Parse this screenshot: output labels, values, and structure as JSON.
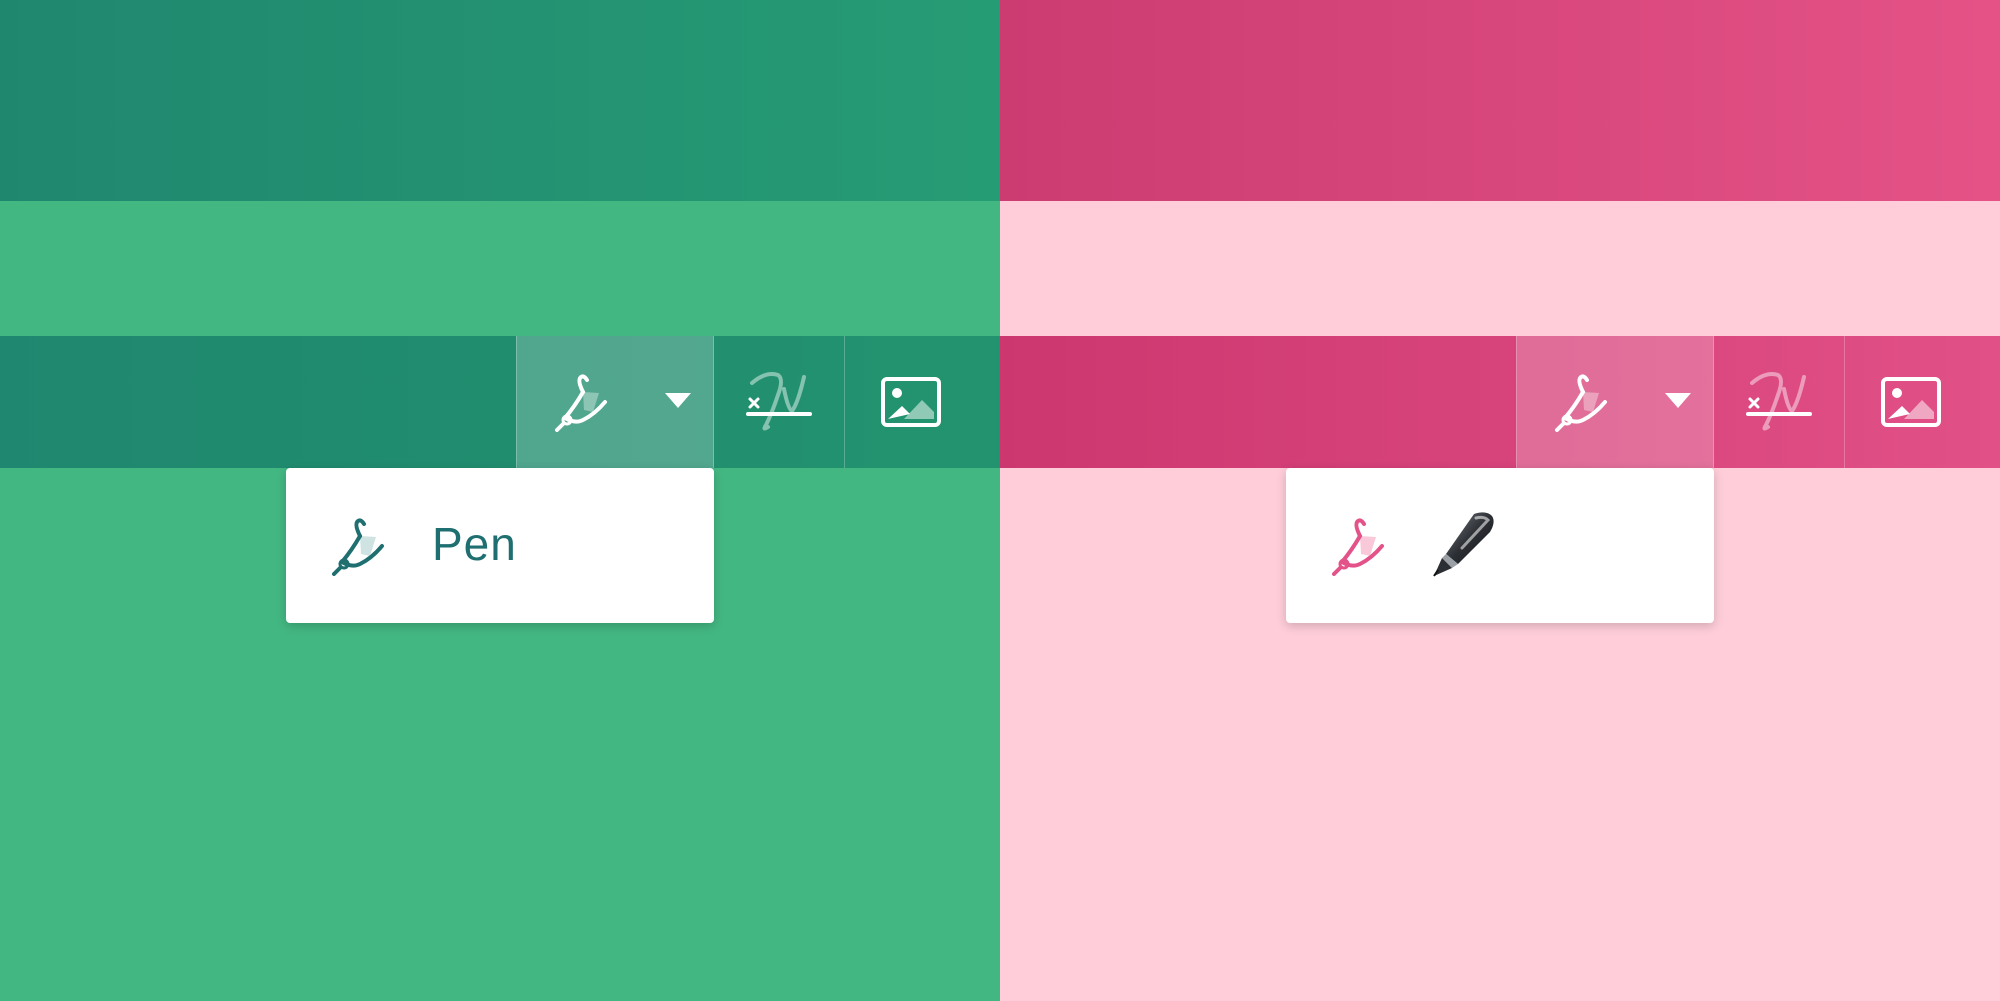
{
  "panels": [
    {
      "theme": "green",
      "colors": {
        "header": "#23936f",
        "content": "#43b782",
        "toolbar": "#20896f",
        "menu_text": "#1f6e70",
        "menu_icon": "#1f6e70"
      },
      "toolbar": {
        "tools": [
          "draw-tool-dropdown",
          "signature-tool",
          "image-tool"
        ]
      },
      "menu": {
        "items": [
          {
            "icon": "pen-tool-icon",
            "label": "Pen"
          }
        ]
      }
    },
    {
      "theme": "pink",
      "colors": {
        "header": "#d94a7e",
        "content": "#fecdd9",
        "toolbar": "#d84379",
        "menu_icon": "#e4528a"
      },
      "toolbar": {
        "tools": [
          "draw-tool-dropdown",
          "signature-tool",
          "image-tool"
        ]
      },
      "menu": {
        "items": [
          {
            "icon": "pen-tool-icon",
            "label_icon": "fountain-pen-emoji"
          }
        ]
      }
    }
  ]
}
